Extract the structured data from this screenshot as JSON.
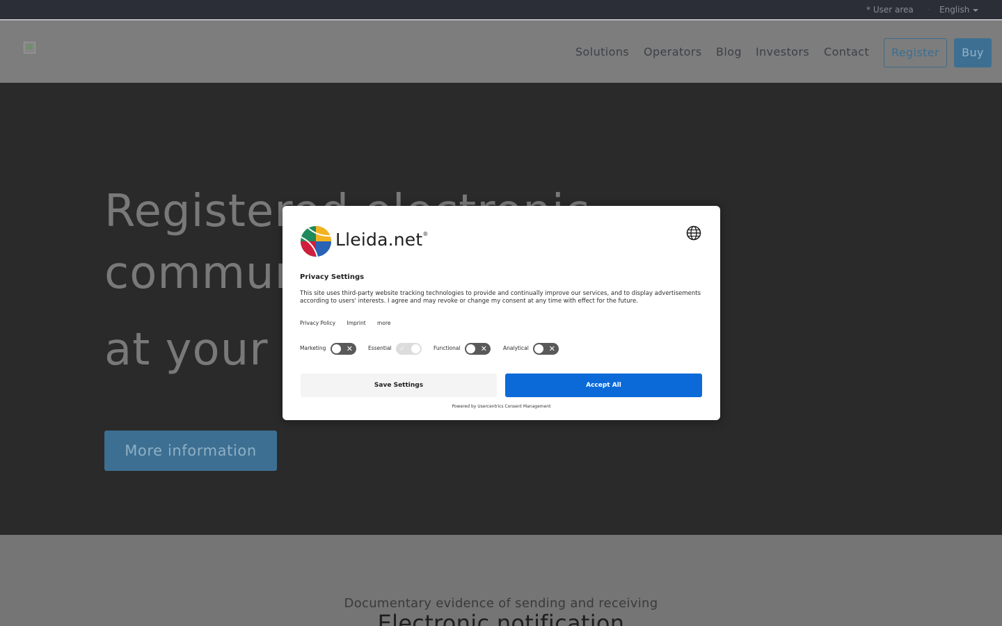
{
  "topbar": {
    "user_area": "*  User area",
    "separator": "·",
    "language": "  English"
  },
  "header": {
    "nav": [
      "Solutions",
      "Operators",
      "Blog",
      "Investors",
      "Contact"
    ],
    "register": "Register",
    "buy": "Buy"
  },
  "hero": {
    "line1": "Registered electronic",
    "line2": "communications",
    "line3": "at your fingertips",
    "cta": "More information"
  },
  "section": {
    "subtitle": "Documentary evidence of sending and receiving",
    "title": "Electronic notification"
  },
  "consent": {
    "brand": "Lleida.net",
    "brand_mark": "®",
    "title": "Privacy Settings",
    "description": "This site uses third-party website tracking technologies to provide and continually improve our services, and to display advertisements according to users' interests. I agree and may revoke or change my consent at any time with effect for the future.",
    "links": [
      "Privacy Policy",
      "Imprint",
      "more"
    ],
    "toggles": [
      {
        "label": "Marketing",
        "on": false
      },
      {
        "label": "Essential",
        "on": true
      },
      {
        "label": "Functional",
        "on": false
      },
      {
        "label": "Analytical",
        "on": false
      }
    ],
    "save": "Save Settings",
    "accept": "Accept All",
    "powered": "Powered by Usercentrics Consent Management",
    "accent_color": "#0b6ad8"
  }
}
